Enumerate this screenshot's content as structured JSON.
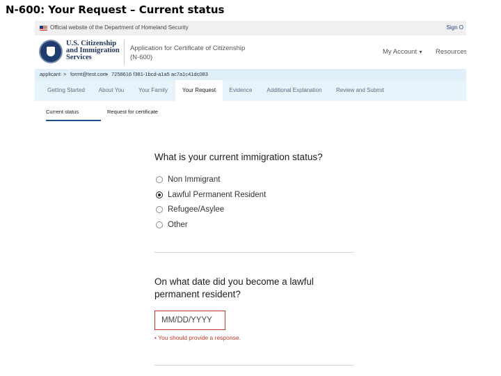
{
  "slide_title": "N-600: Your Request – Current status",
  "gov_banner": {
    "text": "Official website of the Department of Homeland Security",
    "sign_out": "Sign O"
  },
  "header": {
    "agency_lines": [
      "U.S. Citizenship",
      "and Immigration",
      "Services"
    ],
    "app_title_line1": "Application for Certificate of Citizenship",
    "app_title_line2": "(N-600)",
    "my_account": "My Account",
    "resources": "Resources"
  },
  "breadcrumb": {
    "items": [
      "applicant",
      "formt@test.com",
      "7258616 f381-1bcd-a1a5 ac7a1c41dc083"
    ],
    "separator": ">"
  },
  "steps": [
    {
      "label": "Getting Started",
      "active": false
    },
    {
      "label": "About You",
      "active": false
    },
    {
      "label": "Your Family",
      "active": false
    },
    {
      "label": "Your Request",
      "active": true
    },
    {
      "label": "Evidence",
      "active": false
    },
    {
      "label": "Additional Explanation",
      "active": false
    },
    {
      "label": "Review and Submit",
      "active": false
    }
  ],
  "subtabs": [
    {
      "label": "Current status",
      "active": true
    },
    {
      "label": "Request for certificate",
      "active": false
    }
  ],
  "question1": {
    "label": "What is your current immigration status?",
    "options": [
      {
        "label": "Non Immigrant",
        "checked": false
      },
      {
        "label": "Lawful Permanent Resident",
        "checked": true
      },
      {
        "label": "Refugee/Asylee",
        "checked": false
      },
      {
        "label": "Other",
        "checked": false
      }
    ]
  },
  "question2": {
    "label": "On what date did you become a lawful permanent resident?",
    "placeholder": "MM/DD/YYYY",
    "error": "• You should provide a response."
  },
  "colors": {
    "accent": "#1f4f91",
    "error": "#c0392b",
    "nav_background": "#e7f3fb"
  }
}
